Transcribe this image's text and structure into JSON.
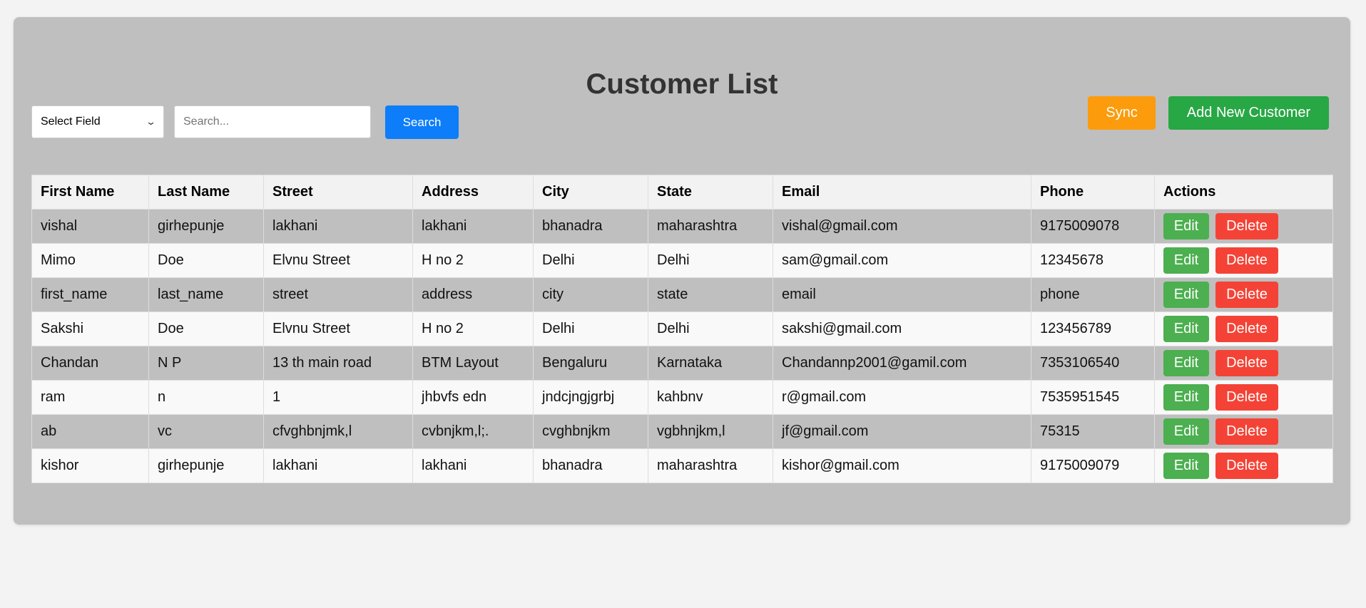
{
  "page": {
    "title": "Customer List"
  },
  "controls": {
    "field_select_value": "Select Field",
    "search_placeholder": "Search...",
    "search_label": "Search",
    "sync_label": "Sync",
    "add_label": "Add New Customer"
  },
  "colors": {
    "card_bg": "#bfbfbf",
    "page_bg": "#f3f3f3",
    "header_row_bg": "#f2f2f2",
    "row_dark_bg": "#bfbfbf",
    "row_light_bg": "#f9f9f9",
    "search_button": "#0d7dfa",
    "sync_button": "#fc9b0c",
    "add_button": "#28a745",
    "edit_button": "#4caf50",
    "delete_button": "#f44336"
  },
  "table": {
    "headers": [
      "First Name",
      "Last Name",
      "Street",
      "Address",
      "City",
      "State",
      "Email",
      "Phone",
      "Actions"
    ],
    "action_labels": {
      "edit": "Edit",
      "delete": "Delete"
    },
    "rows": [
      [
        "vishal",
        "girhepunje",
        "lakhani",
        "lakhani",
        "bhanadra",
        "maharashtra",
        "vishal@gmail.com",
        "9175009078"
      ],
      [
        "Mimo",
        "Doe",
        "Elvnu Street",
        "H no 2",
        "Delhi",
        "Delhi",
        "sam@gmail.com",
        "12345678"
      ],
      [
        "first_name",
        "last_name",
        "street",
        "address",
        "city",
        "state",
        "email",
        "phone"
      ],
      [
        "Sakshi",
        "Doe",
        "Elvnu Street",
        "H no 2",
        "Delhi",
        "Delhi",
        "sakshi@gmail.com",
        "123456789"
      ],
      [
        "Chandan",
        "N P",
        "13 th main road",
        "BTM Layout",
        "Bengaluru",
        "Karnataka",
        "Chandannp2001@gamil.com",
        "7353106540"
      ],
      [
        "ram",
        "n",
        "1",
        "jhbvfs edn",
        "jndcjngjgrbj",
        "kahbnv",
        "r@gmail.com",
        "7535951545"
      ],
      [
        "ab",
        "vc",
        "cfvghbnjmk,l",
        "cvbnjkm,l;.",
        "cvghbnjkm",
        "vgbhnjkm,l",
        "jf@gmail.com",
        "75315"
      ],
      [
        "kishor",
        "girhepunje",
        "lakhani",
        "lakhani",
        "bhanadra",
        "maharashtra",
        "kishor@gmail.com",
        "9175009079"
      ]
    ]
  }
}
